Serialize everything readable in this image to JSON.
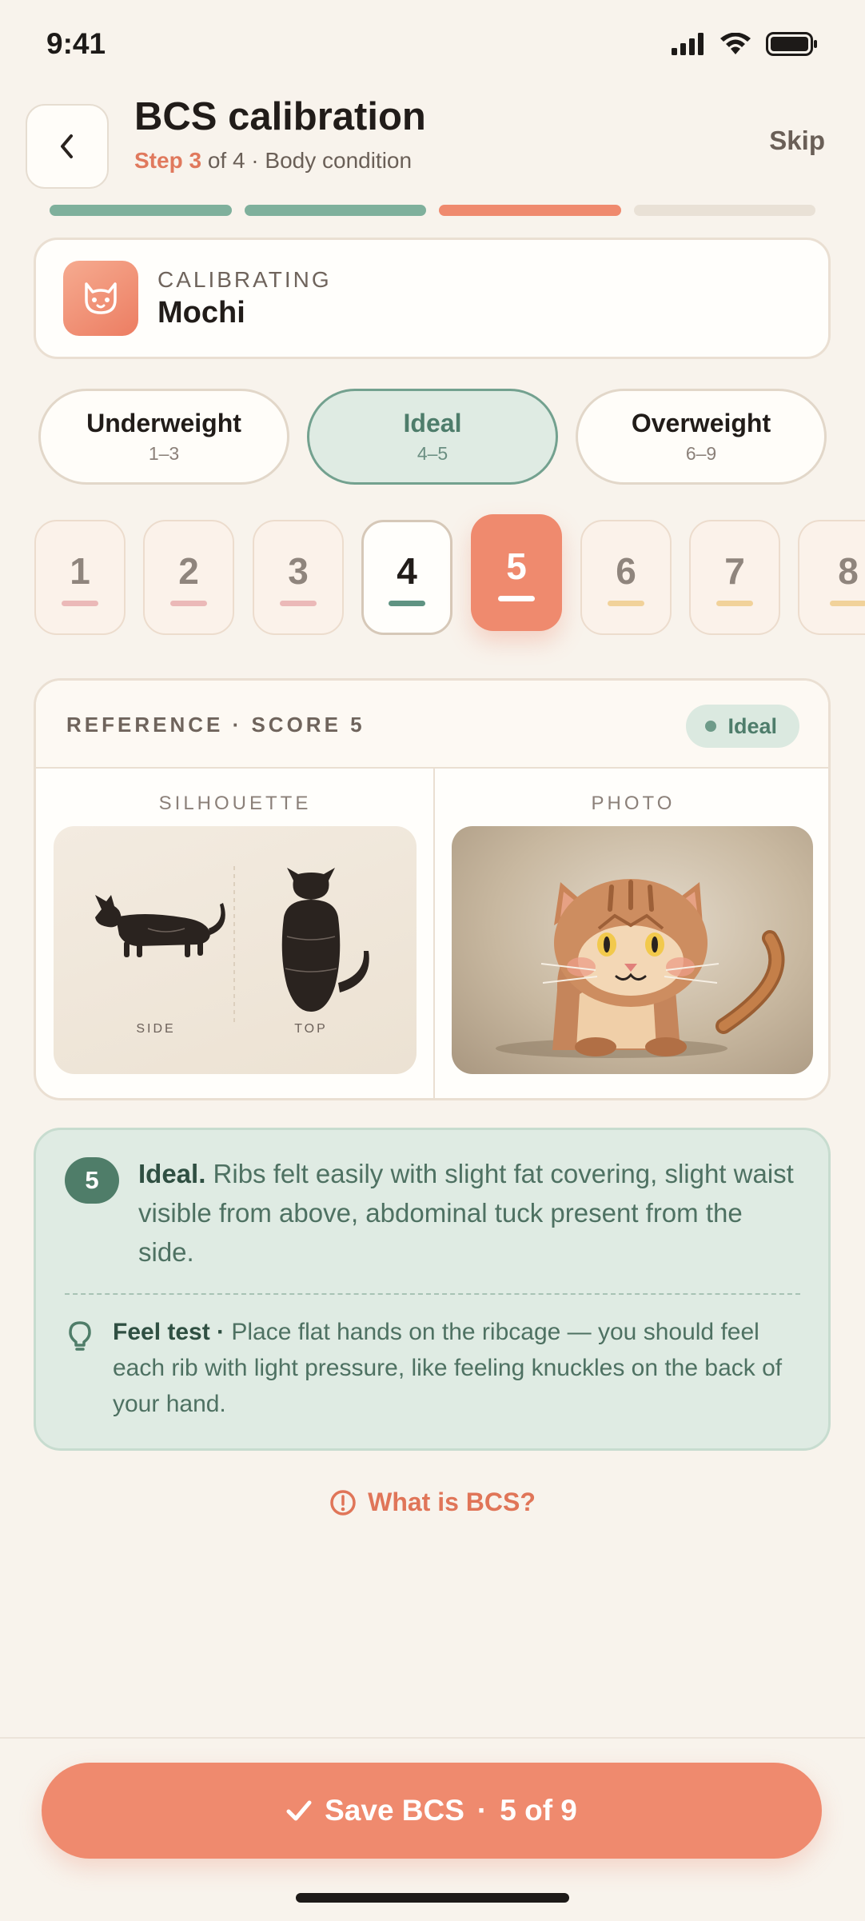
{
  "status_bar": {
    "time": "9:41"
  },
  "header": {
    "title": "BCS calibration",
    "step_prefix": "Step 3",
    "step_suffix": "of 4 · Body condition",
    "skip_label": "Skip"
  },
  "progress": {
    "total_steps": 4,
    "current_step": 3,
    "colors": {
      "done": "#7fb09c",
      "current": "#ef8a6e",
      "todo": "#e9e1d6"
    }
  },
  "calibrating": {
    "label": "CALIBRATING",
    "pet_name": "Mochi"
  },
  "ranges": [
    {
      "label": "Underweight",
      "range": "1–3",
      "active": false
    },
    {
      "label": "Ideal",
      "range": "4–5",
      "active": true
    },
    {
      "label": "Overweight",
      "range": "6–9",
      "active": false
    }
  ],
  "scores": [
    "1",
    "2",
    "3",
    "4",
    "5",
    "6",
    "7",
    "8"
  ],
  "selected_score": "5",
  "reference": {
    "title": "REFERENCE · SCORE 5",
    "badge": "Ideal",
    "silhouette_label": "SILHOUETTE",
    "photo_label": "PHOTO",
    "side_label": "SIDE",
    "top_label": "TOP"
  },
  "description": {
    "number": "5",
    "lead": "Ideal.",
    "text": " Ribs felt easily with slight fat covering, slight waist visible from above, abdominal tuck present from the side.",
    "feel_lead": "Feel test ·",
    "feel_text": " Place flat hands on the ribcage — you should feel each rib with light pressure, like feeling knuckles on the back of your hand."
  },
  "help_link": "What is BCS?",
  "save_button": {
    "label": "Save BCS",
    "separator": "·",
    "count": "5 of 9"
  },
  "colors": {
    "accent": "#ef8a6e",
    "ideal_green": "#4f7d69",
    "background": "#f8f3ec"
  }
}
